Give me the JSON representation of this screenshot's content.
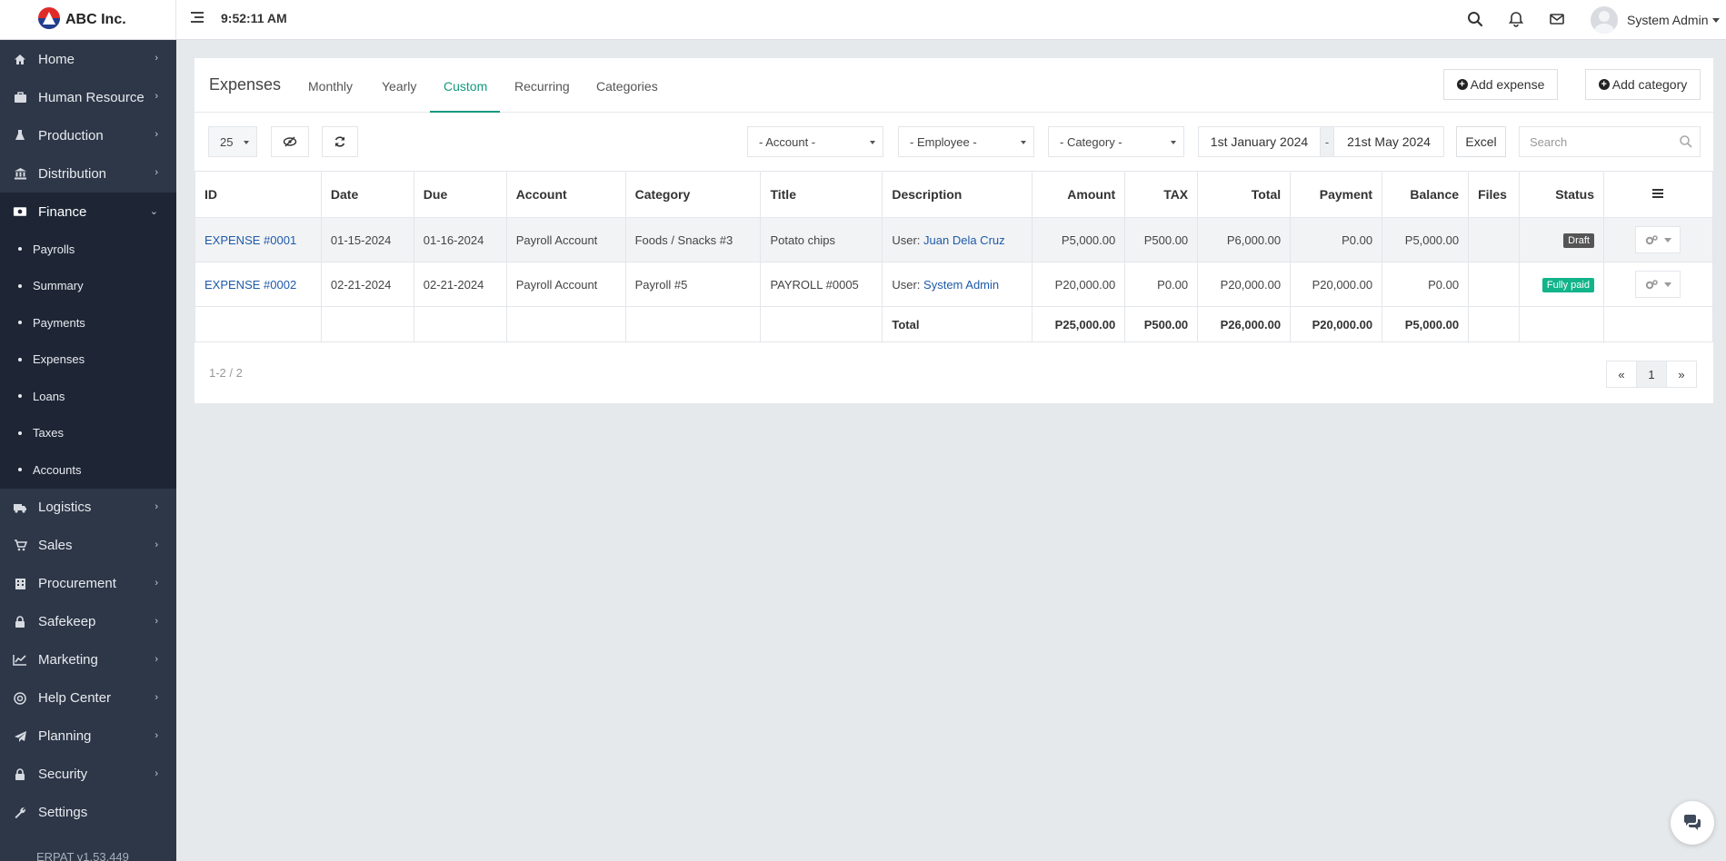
{
  "brand": {
    "name": "ABC Inc."
  },
  "topbar": {
    "time": "9:52:11 AM",
    "user_name": "System Admin"
  },
  "sidebar": {
    "items": [
      {
        "label": "Home",
        "icon": "home-icon"
      },
      {
        "label": "Human Resource",
        "icon": "briefcase-icon"
      },
      {
        "label": "Production",
        "icon": "flask-icon"
      },
      {
        "label": "Distribution",
        "icon": "bank-icon"
      },
      {
        "label": "Finance",
        "icon": "money-icon"
      },
      {
        "label": "Logistics",
        "icon": "truck-icon"
      },
      {
        "label": "Sales",
        "icon": "cart-icon"
      },
      {
        "label": "Procurement",
        "icon": "building-icon"
      },
      {
        "label": "Safekeep",
        "icon": "lock-icon"
      },
      {
        "label": "Marketing",
        "icon": "chart-line-icon"
      },
      {
        "label": "Help Center",
        "icon": "globe-icon"
      },
      {
        "label": "Planning",
        "icon": "paper-plane-icon"
      },
      {
        "label": "Security",
        "icon": "lock-icon"
      },
      {
        "label": "Settings",
        "icon": "wrench-icon"
      }
    ],
    "finance_sub": [
      "Payrolls",
      "Summary",
      "Payments",
      "Expenses",
      "Loans",
      "Taxes",
      "Accounts"
    ],
    "version": "ERPAT v1.53.449"
  },
  "panel": {
    "title": "Expenses",
    "tabs": [
      "Monthly",
      "Yearly",
      "Custom",
      "Recurring",
      "Categories"
    ],
    "active_tab": "Custom",
    "add_expense": "Add expense",
    "add_category": "Add category"
  },
  "filters": {
    "page_size": "25",
    "account": "- Account -",
    "employee": "- Employee -",
    "category": "- Category -",
    "date_from": "1st January 2024",
    "date_sep": "-",
    "date_to": "21st May 2024",
    "excel": "Excel",
    "search_placeholder": "Search"
  },
  "table": {
    "headers": {
      "id": "ID",
      "date": "Date",
      "due": "Due",
      "account": "Account",
      "category": "Category",
      "title": "Title",
      "description": "Description",
      "amount": "Amount",
      "tax": "TAX",
      "total": "Total",
      "payment": "Payment",
      "balance": "Balance",
      "files": "Files",
      "status": "Status"
    },
    "rows": [
      {
        "id": "EXPENSE #0001",
        "date": "01-15-2024",
        "due": "01-16-2024",
        "account": "Payroll Account",
        "category": "Foods / Snacks #3",
        "title": "Potato chips",
        "desc_prefix": "User:",
        "desc_user": "Juan Dela Cruz",
        "amount": "P5,000.00",
        "tax": "P500.00",
        "total": "P6,000.00",
        "payment": "P0.00",
        "balance": "P5,000.00",
        "status": "Draft",
        "status_color": "#555555"
      },
      {
        "id": "EXPENSE #0002",
        "date": "02-21-2024",
        "due": "02-21-2024",
        "account": "Payroll Account",
        "category": "Payroll #5",
        "title": "PAYROLL #0005",
        "desc_prefix": "User:",
        "desc_user": "System Admin",
        "amount": "P20,000.00",
        "tax": "P0.00",
        "total": "P20,000.00",
        "payment": "P20,000.00",
        "balance": "P0.00",
        "status": "Fully paid",
        "status_color": "#12b48a"
      }
    ],
    "totals": {
      "label": "Total",
      "amount": "P25,000.00",
      "tax": "P500.00",
      "total": "P26,000.00",
      "payment": "P20,000.00",
      "balance": "P5,000.00"
    }
  },
  "footer": {
    "range": "1-2 / 2",
    "prev": "«",
    "page": "1",
    "next": "»"
  },
  "colors": {
    "accent": "#12997e",
    "sidebar": "#2d3748",
    "link": "#1e5aa8"
  }
}
